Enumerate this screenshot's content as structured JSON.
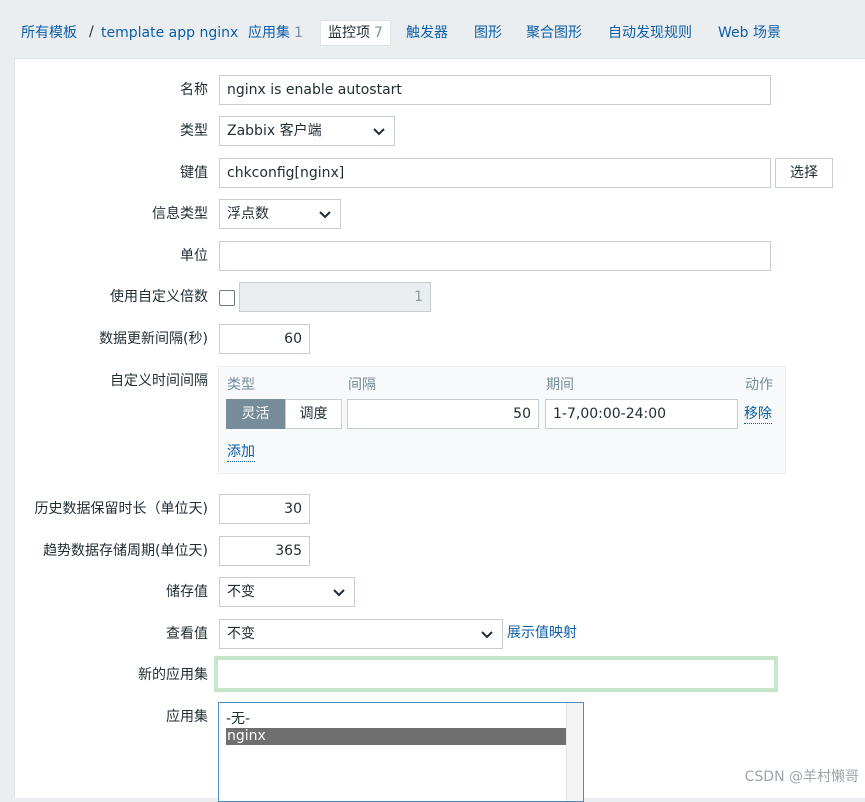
{
  "nav": {
    "all_templates": "所有模板",
    "separator": "/",
    "template_name": "template app nginx",
    "tabs": [
      {
        "label": "应用集",
        "count": "1"
      },
      {
        "label": "监控项",
        "count": "7"
      },
      {
        "label": "触发器"
      },
      {
        "label": "图形"
      },
      {
        "label": "聚合图形"
      },
      {
        "label": "自动发现规则"
      },
      {
        "label": "Web 场景"
      }
    ]
  },
  "form": {
    "name": {
      "label": "名称",
      "value": "nginx is enable autostart"
    },
    "type": {
      "label": "类型",
      "value": "Zabbix 客户端"
    },
    "key": {
      "label": "键值",
      "value": "chkconfig[nginx]",
      "button": "选择"
    },
    "info_type": {
      "label": "信息类型",
      "value": "浮点数"
    },
    "unit": {
      "label": "单位",
      "value": ""
    },
    "custom_multiplier": {
      "label": "使用自定义倍数",
      "value": "1",
      "checked": false
    },
    "update_interval": {
      "label": "数据更新间隔(秒)",
      "value": "60"
    },
    "custom_intervals": {
      "label": "自定义时间间隔",
      "headers": {
        "type": "类型",
        "interval": "间隔",
        "period": "期间",
        "action": "动作"
      },
      "row": {
        "flexible": "灵活",
        "scheduling": "调度",
        "interval": "50",
        "period": "1-7,00:00-24:00",
        "remove": "移除"
      },
      "add": "添加"
    },
    "history": {
      "label": "历史数据保留时长（单位天)",
      "value": "30"
    },
    "trends": {
      "label": "趋势数据存储周期(单位天)",
      "value": "365"
    },
    "store_value": {
      "label": "储存值",
      "value": "不变"
    },
    "show_value": {
      "label": "查看值",
      "value": "不变",
      "mapping_link": "展示值映射"
    },
    "new_application": {
      "label": "新的应用集",
      "value": ""
    },
    "applications": {
      "label": "应用集",
      "options": [
        "-无-",
        "nginx"
      ],
      "selected": "nginx"
    }
  },
  "watermark": "CSDN @羊村懒哥",
  "colors": {
    "link": "#0b5ea8",
    "selected_option": "#6f6f6f",
    "active_segment": "#768d99",
    "new_app_border": "#c7e6c9"
  }
}
